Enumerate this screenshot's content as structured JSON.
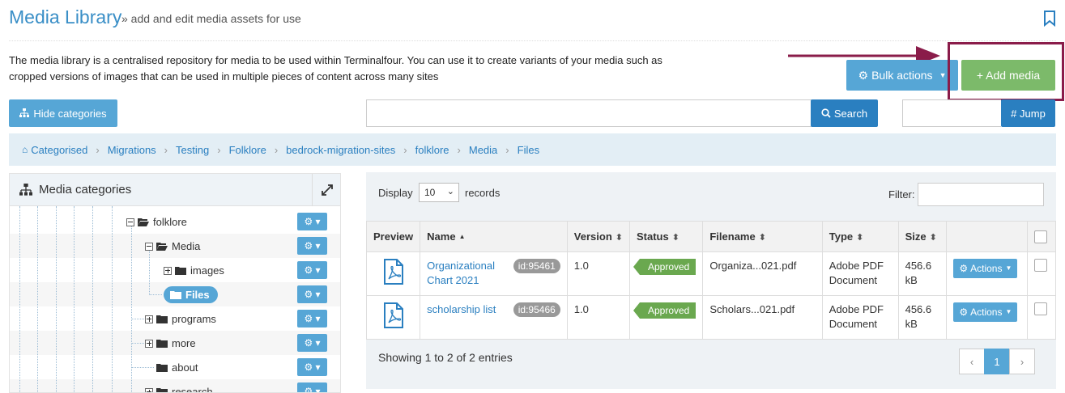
{
  "header": {
    "title": "Media Library",
    "subtitle": "» add and edit media assets for use",
    "description": "The media library is a centralised repository for media to be used within Terminalfour. You can use it to create variants of your media such as cropped versions of images that can be used in multiple pieces of content across many sites"
  },
  "toolbar": {
    "bulk_actions_label": "Bulk actions",
    "add_media_label": "+ Add media",
    "hide_categories_label": "Hide categories",
    "search_label": "Search",
    "search_value": "",
    "jump_label": "# Jump",
    "jump_value": ""
  },
  "breadcrumb": [
    "Categorised",
    "Migrations",
    "Testing",
    "Folklore",
    "bedrock-migration-sites",
    "folklore",
    "Media",
    "Files"
  ],
  "categories": {
    "title": "Media categories",
    "nodes": [
      "folklore",
      "Media",
      "images",
      "Files",
      "programs",
      "more",
      "about",
      "research"
    ]
  },
  "table_controls": {
    "display_label": "Display",
    "display_value": "10",
    "records_label": "records",
    "filter_label": "Filter:",
    "filter_value": ""
  },
  "table": {
    "columns": [
      "Preview",
      "Name",
      "Version",
      "Status",
      "Filename",
      "Type",
      "Size",
      ""
    ],
    "rows": [
      {
        "name": "Organizational Chart 2021",
        "id": "id:95461",
        "version": "1.0",
        "status": "Approved",
        "filename": "Organiza...021.pdf",
        "type": "Adobe PDF Document",
        "size": "456.6 kB",
        "actions": "Actions"
      },
      {
        "name": "scholarship list",
        "id": "id:95466",
        "version": "1.0",
        "status": "Approved",
        "filename": "Scholars...021.pdf",
        "type": "Adobe PDF Document",
        "size": "456.6 kB",
        "actions": "Actions"
      }
    ],
    "summary": "Showing 1 to 2 of 2 entries",
    "pagination": {
      "prev": "‹",
      "current": "1",
      "next": "›"
    }
  },
  "colors": {
    "accent_blue": "#56a6d6",
    "dark_blue": "#2a7fc0",
    "green": "#7cba6a",
    "highlight": "#8a1c4a"
  },
  "icons": [
    "bookmark-icon",
    "gear-icon",
    "hierarchy-icon",
    "search-icon",
    "home-icon",
    "expand-icon",
    "folder-icon",
    "pdf-icon",
    "caret-down-icon"
  ]
}
